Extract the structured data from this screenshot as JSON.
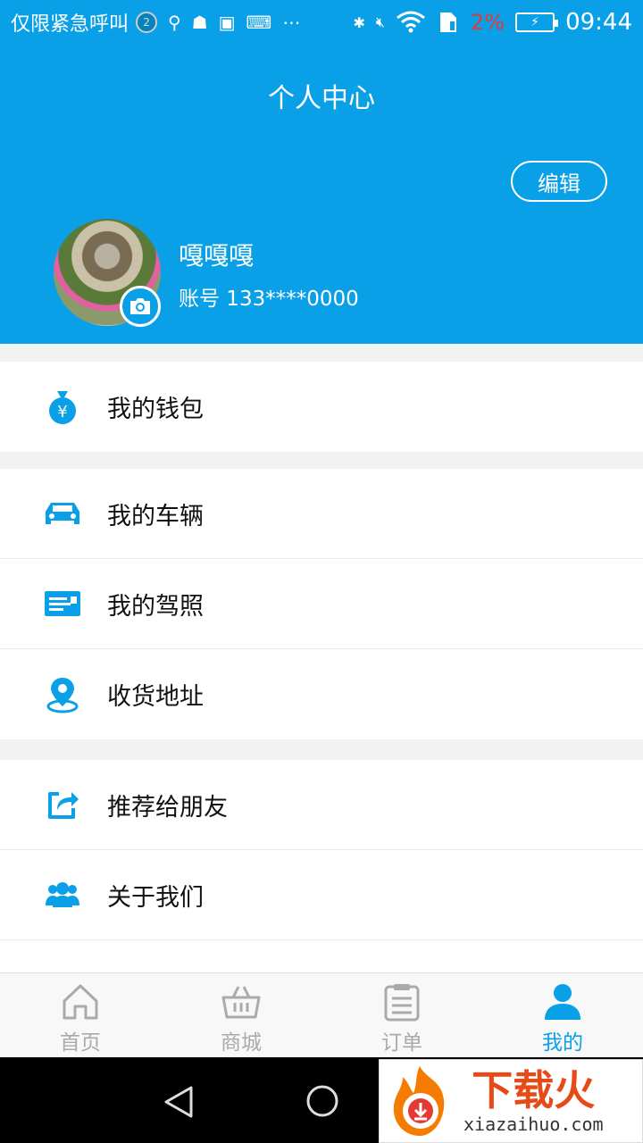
{
  "status_bar": {
    "carrier": "仅限紧急呼叫",
    "notification_count": "2",
    "battery_percent": "2%",
    "time": "09:44"
  },
  "header": {
    "title": "个人中心",
    "edit_label": "编辑",
    "user_name": "嘎嘎嘎",
    "account": "账号 133****0000"
  },
  "menu": {
    "group1": [
      {
        "label": "我的钱包",
        "icon": "wallet-icon"
      }
    ],
    "group2": [
      {
        "label": "我的车辆",
        "icon": "car-icon"
      },
      {
        "label": "我的驾照",
        "icon": "license-icon"
      },
      {
        "label": "收货地址",
        "icon": "location-icon"
      }
    ],
    "group3": [
      {
        "label": "推荐给朋友",
        "icon": "share-icon"
      },
      {
        "label": "关于我们",
        "icon": "group-icon"
      }
    ]
  },
  "tabbar": [
    {
      "label": "首页",
      "icon": "home-icon",
      "active": false
    },
    {
      "label": "商城",
      "icon": "basket-icon",
      "active": false
    },
    {
      "label": "订单",
      "icon": "clipboard-icon",
      "active": false
    },
    {
      "label": "我的",
      "icon": "person-icon",
      "active": true
    }
  ],
  "watermark": {
    "title": "下载火",
    "subtitle": "xiazaihuo.com"
  },
  "colors": {
    "accent": "#0aa0e8",
    "battery_warning": "#e53935"
  }
}
